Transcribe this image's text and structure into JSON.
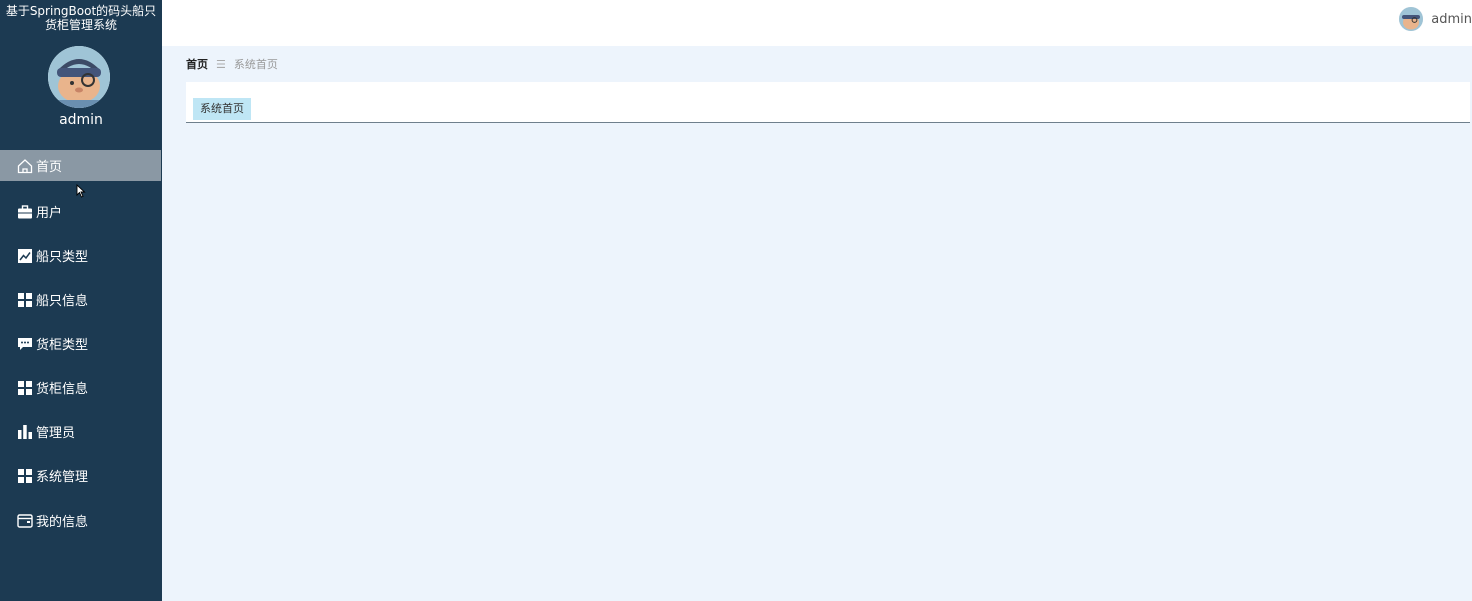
{
  "app": {
    "title_line1": "基于SpringBoot的码头船只",
    "title_line2": "货柜管理系统"
  },
  "sidebar": {
    "user_name": "admin",
    "items": [
      {
        "label": "首页",
        "icon": "home-icon",
        "active": true
      },
      {
        "label": "用户",
        "icon": "briefcase-icon",
        "active": false
      },
      {
        "label": "船只类型",
        "icon": "line-chart-icon",
        "active": false
      },
      {
        "label": "船只信息",
        "icon": "grid-icon",
        "active": false
      },
      {
        "label": "货柜类型",
        "icon": "chat-icon",
        "active": false
      },
      {
        "label": "货柜信息",
        "icon": "grid-icon",
        "active": false
      },
      {
        "label": "管理员",
        "icon": "bar-chart-icon",
        "active": false
      },
      {
        "label": "系统管理",
        "icon": "grid-icon",
        "active": false
      },
      {
        "label": "我的信息",
        "icon": "wallet-icon",
        "active": false
      }
    ]
  },
  "header": {
    "user_name": "admin"
  },
  "breadcrumb": {
    "home": "首页",
    "separator": "☰",
    "current": "系统首页"
  },
  "tabs": [
    {
      "label": "系统首页"
    }
  ],
  "colors": {
    "sidebar_bg": "#1c3a52",
    "active_item_bg": "#8a98a4",
    "page_bg": "#edf4fc",
    "tab_bg": "#bfe6f5"
  }
}
